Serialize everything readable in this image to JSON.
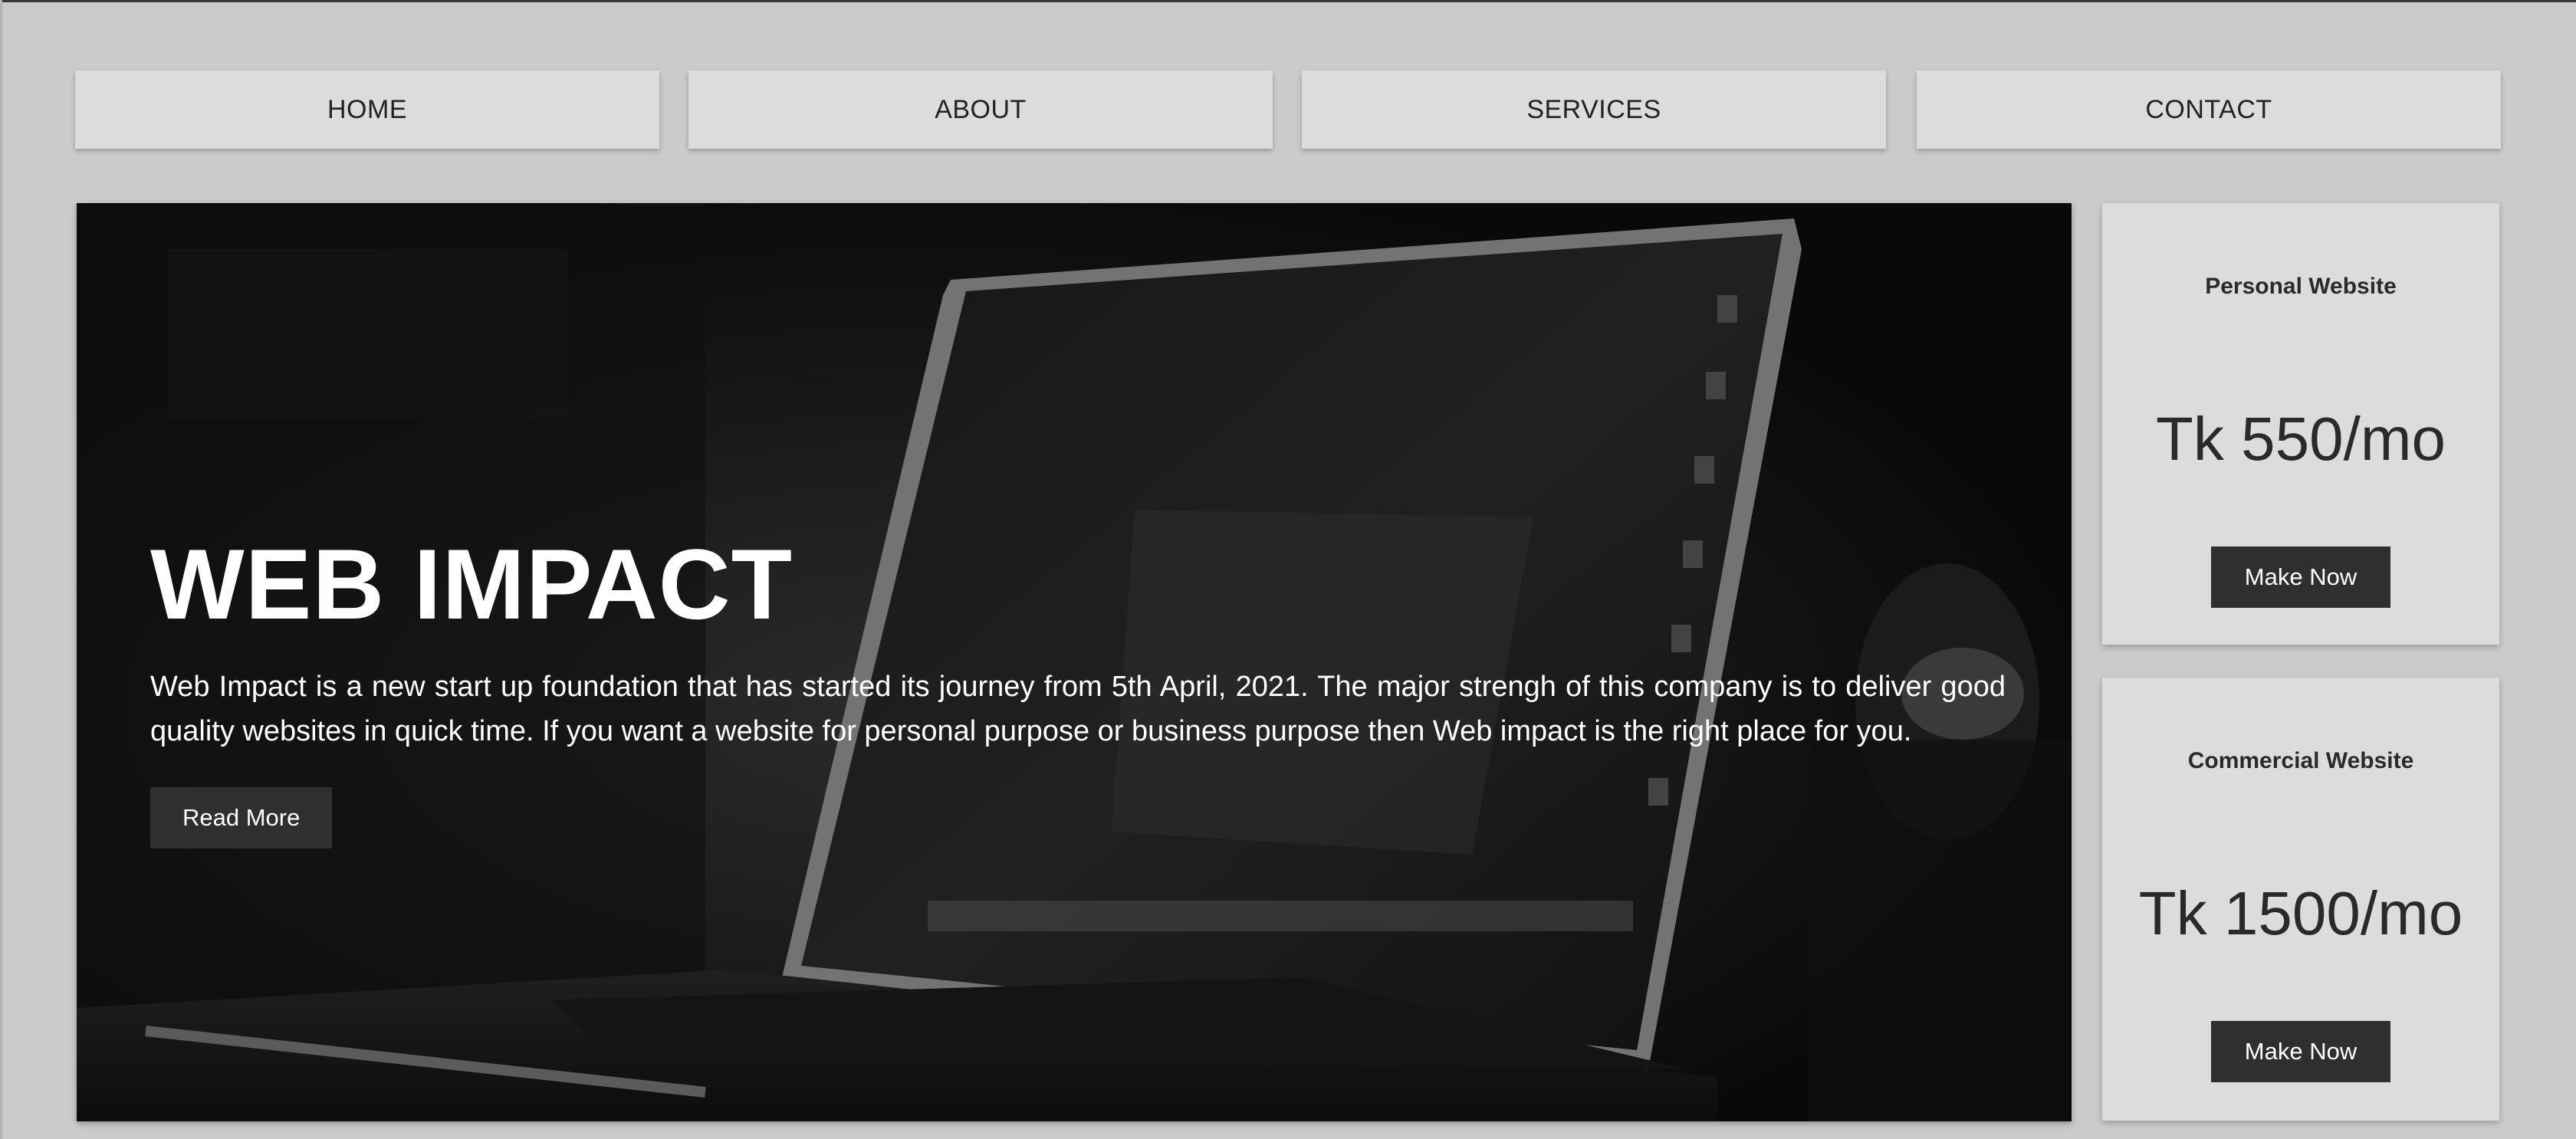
{
  "nav": {
    "items": [
      {
        "label": "HOME"
      },
      {
        "label": "ABOUT"
      },
      {
        "label": "SERVICES"
      },
      {
        "label": "CONTACT"
      }
    ]
  },
  "hero": {
    "title": "WEB IMPACT",
    "description": "Web Impact is a new start up foundation that has started its journey from 5th April, 2021. The major strengh of this company is to deliver good quality websites in quick time. If you want a website for personal purpose or business purpose then Web impact is the right place for you.",
    "button_label": "Read More",
    "background_image": "laptop-on-desk-photo"
  },
  "plans": [
    {
      "title": "Personal Website",
      "price": "Tk 550/mo",
      "button_label": "Make Now"
    },
    {
      "title": "Commercial Website",
      "price": "Tk 1500/mo",
      "button_label": "Make Now"
    }
  ],
  "colors": {
    "page_background": "#cbcbcb",
    "nav_background": "#dcdcdc",
    "card_background": "#dcdcdc",
    "button_background": "#2f2f2f",
    "button_text": "#ffffff",
    "hero_text": "#ffffff"
  }
}
